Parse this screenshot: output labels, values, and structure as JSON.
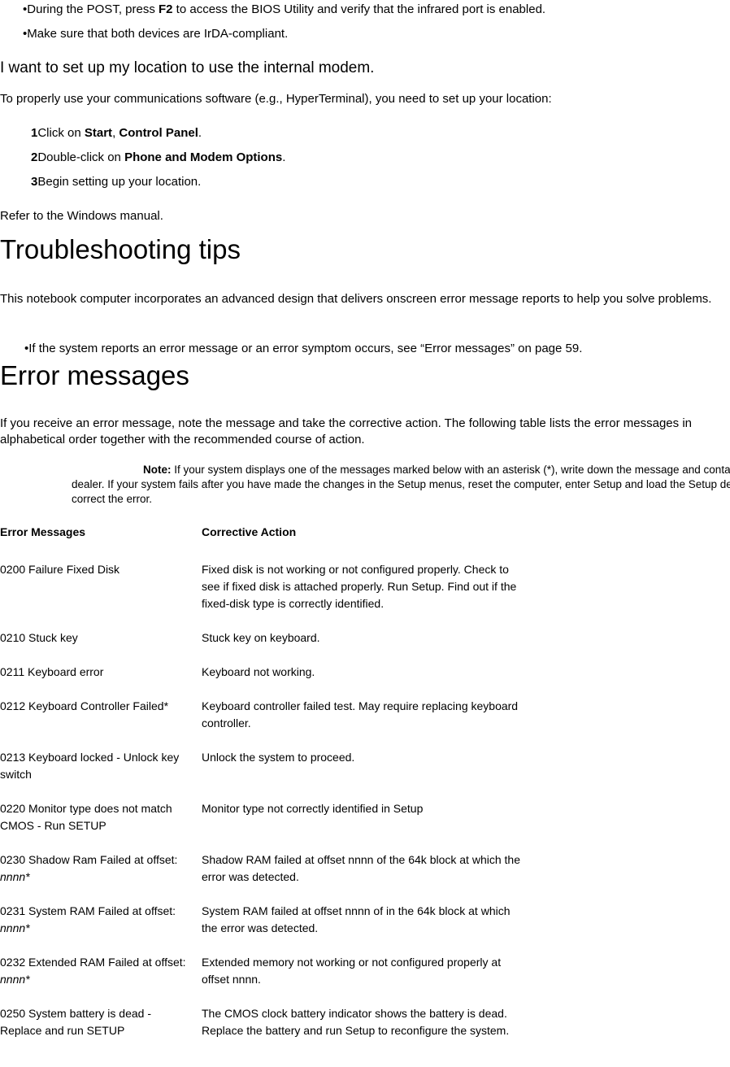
{
  "top_bullets": [
    {
      "text_before": "During the POST, press ",
      "bold": "F2",
      "text_after": " to access the BIOS Utility and verify that the infrared port is enabled."
    },
    {
      "text_before": "Make sure that both devices are IrDA-compliant.",
      "bold": "",
      "text_after": ""
    }
  ],
  "modem_section": {
    "heading": "I want to set up my location to use the internal modem.",
    "intro": "To properly use your communications software (e.g., HyperTerminal), you need to set up your location:",
    "steps": [
      {
        "num": "1",
        "before": "Click on ",
        "bold1": "Start",
        "mid": ", ",
        "bold2": "Control Panel",
        "after": "."
      },
      {
        "num": "2",
        "before": "Double-click on ",
        "bold1": "Phone and Modem Options",
        "mid": "",
        "bold2": "",
        "after": "."
      },
      {
        "num": "3",
        "before": "Begin setting up your location.",
        "bold1": "",
        "mid": "",
        "bold2": "",
        "after": ""
      }
    ],
    "refer": "Refer to the Windows manual."
  },
  "troubleshooting": {
    "heading": "Troubleshooting tips",
    "intro": "This notebook computer incorporates an advanced design that delivers onscreen error message reports to help you solve problems.",
    "bullet": "If the system reports an error message or an error symptom occurs, see “Error messages” on page 59."
  },
  "error_messages": {
    "heading": "Error messages",
    "intro": "If you receive an error message, note the message and take the corrective action.  The following table lists the error messages in alphabetical order together with the recommended course of action.",
    "note_label": "Note:",
    "note_text": " If your system displays one of the messages marked below with an asterisk (*), write down the message and contact your dealer. If your system fails after you have made the changes in the Setup menus, reset the computer, enter Setup and load the Setup defaults to correct the error.",
    "table": {
      "headers": [
        "Error Messages",
        "Corrective Action"
      ],
      "rows": [
        {
          "message_plain": "0200 Failure Fixed Disk",
          "message_italic": "",
          "action": "Fixed disk is not working or not configured properly. Check to see if fixed disk is attached properly. Run Setup. Find out if the fixed-disk type is correctly identified."
        },
        {
          "message_plain": "0210 Stuck key",
          "message_italic": "",
          "action": "Stuck key on keyboard."
        },
        {
          "message_plain": "0211 Keyboard error",
          "message_italic": "",
          "action": "Keyboard not working."
        },
        {
          "message_plain": "0212 Keyboard Controller Failed*",
          "message_italic": "",
          "action": "Keyboard controller failed test. May require replacing keyboard controller."
        },
        {
          "message_plain": "0213 Keyboard locked - Unlock key switch",
          "message_italic": "",
          "action": "Unlock the system to proceed."
        },
        {
          "message_plain": "0220 Monitor type does not match CMOS - Run SETUP",
          "message_italic": "",
          "action": "Monitor type not correctly identified in Setup"
        },
        {
          "message_plain": "0230 Shadow Ram Failed at offset: ",
          "message_italic": "nnnn*",
          "action": "Shadow RAM failed at offset nnnn of the 64k block at which the error was detected."
        },
        {
          "message_plain": "0231 System RAM Failed at offset: ",
          "message_italic": "nnnn*",
          "action": "System RAM failed at offset nnnn of in the 64k block at which the error was detected."
        },
        {
          "message_plain": "0232 Extended RAM Failed at offset: ",
          "message_italic": "nnnn*",
          "action": "Extended memory not working or not configured properly at offset nnnn."
        },
        {
          "message_plain": "0250 System battery is dead - Replace and run SETUP",
          "message_italic": "",
          "action": "The CMOS clock battery indicator shows the battery is dead. Replace the battery and run Setup to reconfigure the system."
        }
      ]
    }
  }
}
